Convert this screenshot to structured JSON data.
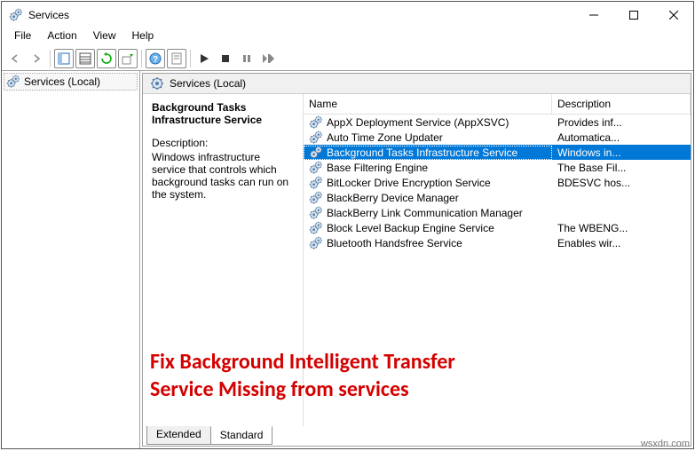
{
  "window": {
    "title": "Services"
  },
  "menubar": {
    "file": "File",
    "action": "Action",
    "view": "View",
    "help": "Help"
  },
  "tree": {
    "root": "Services (Local)"
  },
  "header": {
    "label": "Services (Local)"
  },
  "detail": {
    "name": "Background Tasks Infrastructure Service",
    "desc_label": "Description:",
    "desc": "Windows infrastructure service that controls which background tasks can run on the system."
  },
  "columns": {
    "name": "Name",
    "desc": "Description"
  },
  "rows": [
    {
      "name": "AppX Deployment Service (AppXSVC)",
      "desc": "Provides inf..."
    },
    {
      "name": "Auto Time Zone Updater",
      "desc": "Automatica..."
    },
    {
      "name": "Background Tasks Infrastructure Service",
      "desc": "Windows in...",
      "selected": true
    },
    {
      "name": "Base Filtering Engine",
      "desc": "The Base Fil..."
    },
    {
      "name": "BitLocker Drive Encryption Service",
      "desc": "BDESVC hos..."
    },
    {
      "name": "BlackBerry Device Manager",
      "desc": ""
    },
    {
      "name": "BlackBerry Link Communication Manager",
      "desc": ""
    },
    {
      "name": "Block Level Backup Engine Service",
      "desc": "The WBENG..."
    },
    {
      "name": "Bluetooth Handsfree Service",
      "desc": "Enables wir..."
    }
  ],
  "overlay": {
    "line1": "Fix Background Intelligent Transfer",
    "line2": "Service Missing from services"
  },
  "tabs": {
    "extended": "Extended",
    "standard": "Standard"
  },
  "watermark": "wsxdn.com"
}
